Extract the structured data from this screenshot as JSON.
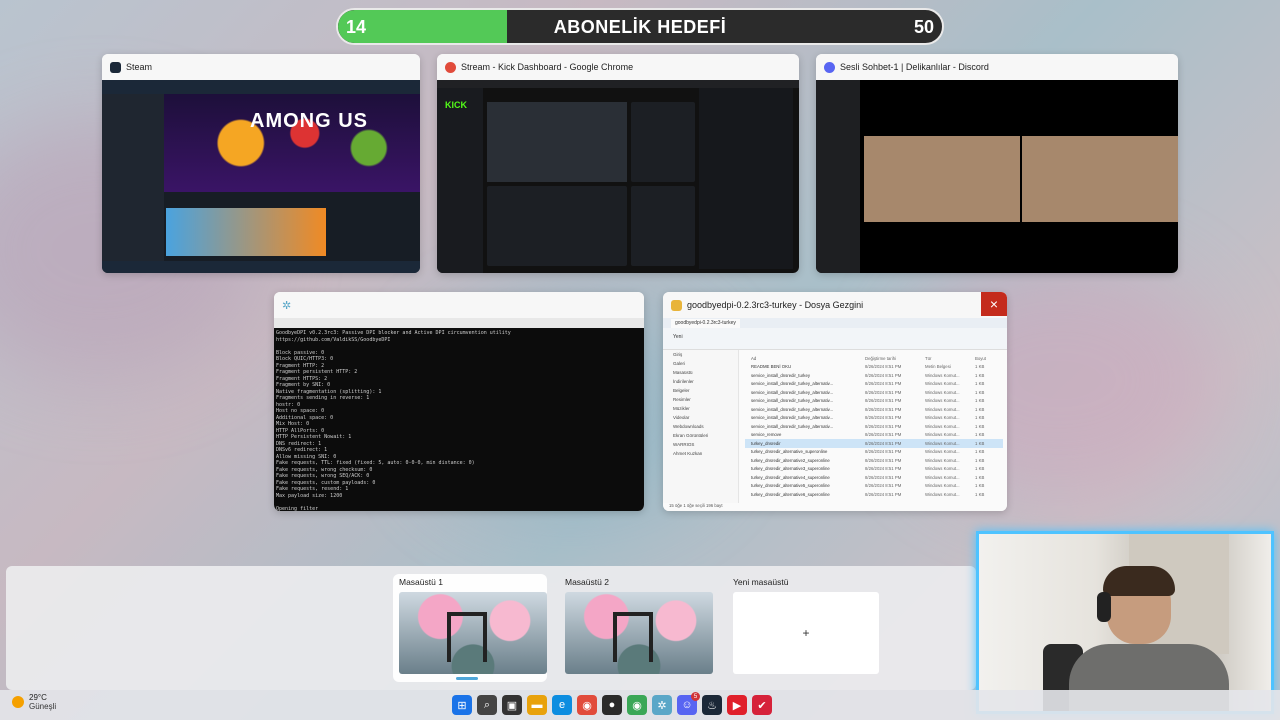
{
  "goal": {
    "current": "14",
    "title": "ABONELİK HEDEFİ",
    "max": "50",
    "progress_fraction": 0.28,
    "fill_color": "#53c957"
  },
  "windows": {
    "steam": {
      "title": "Steam",
      "hero_text": "AMONG US",
      "icon": "steam-icon",
      "color": "#1b2838"
    },
    "kick": {
      "title": "Stream - Kick Dashboard - Google Chrome",
      "logo": "KICK",
      "icon": "chrome-icon",
      "color": "#53fc18"
    },
    "discord": {
      "title": "Sesli Sohbet-1 | Delikanlılar - Discord",
      "icon": "discord-icon",
      "color": "#5865f2"
    },
    "terminal": {
      "title": "",
      "icon": "goodbyedpi-icon",
      "lines": [
        "GoodbyeDPI v0.2.3rc3: Passive DPI blocker and Active DPI circumvention utility",
        "https://github.com/ValdikSS/GoodbyeDPI",
        "",
        "Block passive: 0",
        "Block QUIC/HTTP3: 0",
        "Fragment HTTP: 2",
        "Fragment persistent HTTP: 2",
        "Fragment HTTPS: 2",
        "Fragment by SNI: 0",
        "Native fragmentation (splitting): 1",
        "Fragments sending in reverse: 1",
        "hostr: 0",
        "Host no space: 0",
        "Additional space: 0",
        "Mix Host: 0",
        "HTTP AllPorts: 0",
        "HTTP Persistent Nowait: 1",
        "DNS redirect: 1",
        "DNSv6 redirect: 1",
        "Allow missing SNI: 0",
        "Fake requests, TTL: fixed (fixed: 5, auto: 0-0-0, min distance: 0)",
        "Fake requests, wrong checksum: 0",
        "Fake requests, wrong SEQ/ACK: 0",
        "Fake requests, custom payloads: 0",
        "Fake requests, resend: 1",
        "Max payload size: 1200",
        "",
        "Opening filter",
        "Filter activated, GoodbyeDPI is now running!"
      ]
    },
    "explorer": {
      "title": "goodbyedpi-0.2.3rc3-turkey - Dosya Gezgini",
      "icon": "folder-icon",
      "tab": "goodbyedpi-0.2.3rc3-turkey",
      "new_label": "Yeni",
      "nav_items": [
        "Giriş",
        "Galeri",
        "Masaüstü",
        "İndirilenler",
        "Belgeler",
        "Resimler",
        "Müzikler",
        "Videolar",
        "Webdownloads",
        "Ekran Görüntüleri",
        "WARRIOS",
        "Ahmet Kuzkan"
      ],
      "columns": [
        "Ad",
        "Değiştirme tarihi",
        "Tür",
        "Boyut"
      ],
      "files": [
        {
          "name": "README BENİ OKU",
          "date": "8/26/2024 8:51 PM",
          "type": "Metin Belgesi",
          "size": "1 KB"
        },
        {
          "name": "service_install_dnsredir_turkey",
          "date": "8/26/2024 8:51 PM",
          "type": "Windows Komut...",
          "size": "1 KB"
        },
        {
          "name": "service_install_dnsredir_turkey_alternativ...",
          "date": "8/26/2024 8:51 PM",
          "type": "Windows Komut...",
          "size": "1 KB"
        },
        {
          "name": "service_install_dnsredir_turkey_alternativ...",
          "date": "8/26/2024 8:51 PM",
          "type": "Windows Komut...",
          "size": "1 KB"
        },
        {
          "name": "service_install_dnsredir_turkey_alternativ...",
          "date": "8/26/2024 8:51 PM",
          "type": "Windows Komut...",
          "size": "1 KB"
        },
        {
          "name": "service_install_dnsredir_turkey_alternativ...",
          "date": "8/26/2024 8:51 PM",
          "type": "Windows Komut...",
          "size": "1 KB"
        },
        {
          "name": "service_install_dnsredir_turkey_alternativ...",
          "date": "8/26/2024 8:51 PM",
          "type": "Windows Komut...",
          "size": "1 KB"
        },
        {
          "name": "service_install_dnsredir_turkey_alternativ...",
          "date": "8/26/2024 8:51 PM",
          "type": "Windows Komut...",
          "size": "1 KB"
        },
        {
          "name": "service_remove",
          "date": "8/26/2024 8:51 PM",
          "type": "Windows Komut...",
          "size": "1 KB"
        },
        {
          "name": "turkey_dnsredir",
          "date": "8/26/2024 8:51 PM",
          "type": "Windows Komut...",
          "size": "1 KB"
        },
        {
          "name": "turkey_dnsredir_alternative_superonline",
          "date": "8/26/2024 8:51 PM",
          "type": "Windows Komut...",
          "size": "1 KB"
        },
        {
          "name": "turkey_dnsredir_alternative2_superonline",
          "date": "8/26/2024 8:51 PM",
          "type": "Windows Komut...",
          "size": "1 KB"
        },
        {
          "name": "turkey_dnsredir_alternative3_superonline",
          "date": "8/26/2024 8:51 PM",
          "type": "Windows Komut...",
          "size": "1 KB"
        },
        {
          "name": "turkey_dnsredir_alternative4_superonline",
          "date": "8/26/2024 8:51 PM",
          "type": "Windows Komut...",
          "size": "1 KB"
        },
        {
          "name": "turkey_dnsredir_alternative5_superonline",
          "date": "8/26/2024 8:51 PM",
          "type": "Windows Komut...",
          "size": "1 KB"
        },
        {
          "name": "turkey_dnsredir_alternative6_superonline",
          "date": "8/26/2024 8:51 PM",
          "type": "Windows Komut...",
          "size": "1 KB"
        }
      ],
      "status": "15 öğe    1 öğe seçili  196 bayt"
    }
  },
  "desktops": [
    {
      "label": "Masaüstü 1",
      "active": true
    },
    {
      "label": "Masaüstü 2",
      "active": false
    },
    {
      "label": "Yeni masaüstü",
      "plus": "+"
    }
  ],
  "weather": {
    "temp": "29°C",
    "desc": "Güneşli",
    "icon": "sun-icon"
  },
  "taskbar": {
    "icons": [
      {
        "name": "start-icon",
        "color": "#1a73e8",
        "glyph": "⊞"
      },
      {
        "name": "search-icon",
        "color": "#444",
        "glyph": "⌕"
      },
      {
        "name": "task-view-icon",
        "color": "#333",
        "glyph": "▣"
      },
      {
        "name": "file-explorer-icon",
        "color": "#e8a20c",
        "glyph": "▬"
      },
      {
        "name": "edge-icon",
        "color": "#0c8de0",
        "glyph": "e"
      },
      {
        "name": "chrome-icon",
        "color": "#e14b3b",
        "glyph": "◉"
      },
      {
        "name": "obs-icon",
        "color": "#2b2b2b",
        "glyph": "●"
      },
      {
        "name": "chrome-profile-icon",
        "color": "#3aa757",
        "glyph": "◉"
      },
      {
        "name": "goodbyedpi-icon",
        "color": "#5aa7c8",
        "glyph": "✲"
      },
      {
        "name": "discord-icon",
        "color": "#5865f2",
        "glyph": "☺",
        "badge": "5"
      },
      {
        "name": "steam-icon",
        "color": "#1b2838",
        "glyph": "♨"
      },
      {
        "name": "youtube-music-icon",
        "color": "#e0202b",
        "glyph": "▶"
      },
      {
        "name": "app-icon",
        "color": "#d6223a",
        "glyph": "✔"
      }
    ]
  }
}
